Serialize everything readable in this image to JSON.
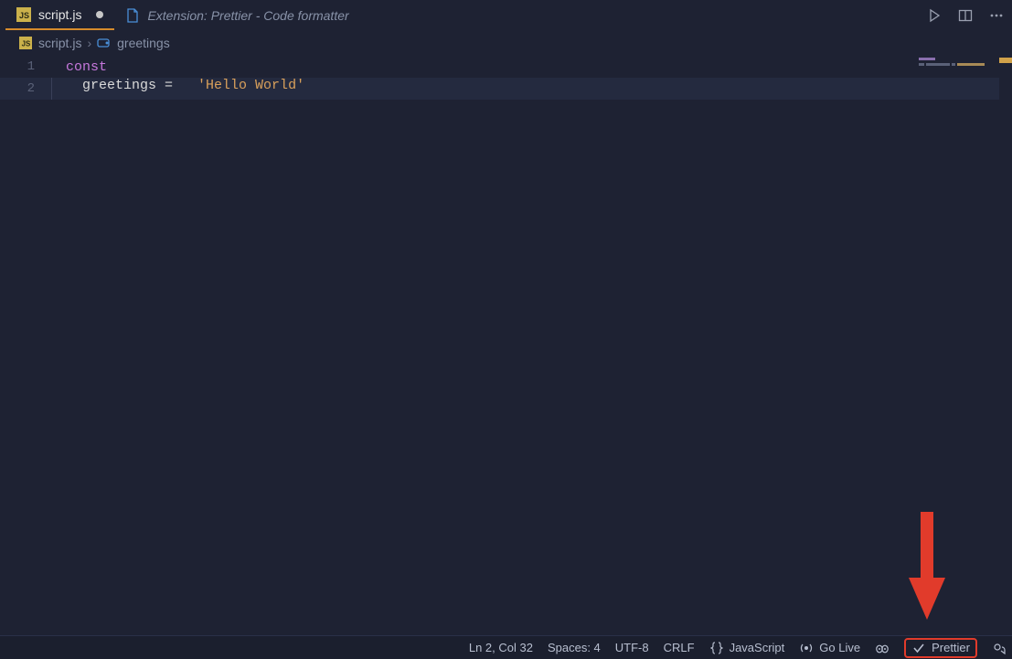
{
  "tabs": {
    "active": {
      "filename": "script.js",
      "icon": "js-file-icon",
      "dirty": true
    },
    "extension": {
      "label": "Extension: Prettier - Code formatter",
      "icon": "preview-file-icon"
    }
  },
  "toolbar": {
    "run_icon": "play-icon",
    "split_icon": "split-editor-icon",
    "more_icon": "ellipsis-icon"
  },
  "breadcrumb": {
    "file_icon": "js-file-icon",
    "file": "script.js",
    "sep": "›",
    "symbol_icon": "variable-symbol-icon",
    "symbol": "greetings"
  },
  "editor": {
    "lines": [
      {
        "num": "1",
        "tokens": [
          {
            "cls": "tok-kw",
            "t": "const"
          }
        ],
        "current": false,
        "indent": 0
      },
      {
        "num": "2",
        "tokens": [
          {
            "cls": "tok-var",
            "t": "greetings "
          },
          {
            "cls": "tok-op",
            "t": "="
          },
          {
            "cls": "",
            "t": "   "
          },
          {
            "cls": "tok-str",
            "t": "'Hello World'"
          }
        ],
        "current": true,
        "indent": 1
      }
    ]
  },
  "statusbar": {
    "cursor": "Ln 2, Col 32",
    "spaces": "Spaces: 4",
    "encoding": "UTF-8",
    "eol": "CRLF",
    "lang_icon": "braces-icon",
    "language": "JavaScript",
    "golive_icon": "broadcast-icon",
    "golive": "Go Live",
    "copilot_icon": "copilot-icon",
    "prettier_check_icon": "check-icon",
    "prettier": "Prettier",
    "feedback_icon": "feedback-icon"
  },
  "annotation": {
    "arrow_color": "#e13b2b"
  }
}
